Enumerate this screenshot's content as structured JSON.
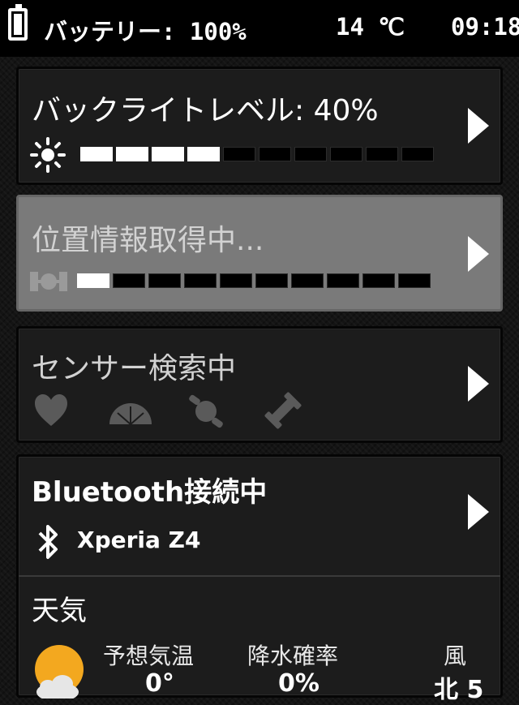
{
  "status_bar": {
    "battery_label": "バッテリー: 100%",
    "battery_level": 1.0,
    "temperature": "14 ℃",
    "time": "09:18"
  },
  "backlight": {
    "title": "バックライトレベル: 40%",
    "level_segments_on": 4,
    "level_segments_total": 10,
    "icon": "sun-icon"
  },
  "gps": {
    "title": "位置情報取得中...",
    "progress_segments_on": 1,
    "progress_segments_total": 10,
    "icon": "satellite-icon"
  },
  "sensors": {
    "title": "センサー検索中",
    "icons": [
      "heart-icon",
      "speedometer-icon",
      "cadence-icon",
      "dumbbell-icon"
    ]
  },
  "bluetooth": {
    "title": "Bluetooth接続中",
    "device": "Xperia Z4",
    "icon": "bluetooth-icon"
  },
  "weather": {
    "title": "天気",
    "icon": "partly-cloudy-icon",
    "columns": [
      {
        "label": "予想気温",
        "value": "0°"
      },
      {
        "label": "降水確率",
        "value": "0%"
      },
      {
        "label": "風",
        "value": "北 5"
      }
    ]
  },
  "colors": {
    "background": "#141414",
    "card": "#1c1c1c",
    "card_active": "#7a7a7a",
    "accent_sun": "#f3a81f"
  }
}
